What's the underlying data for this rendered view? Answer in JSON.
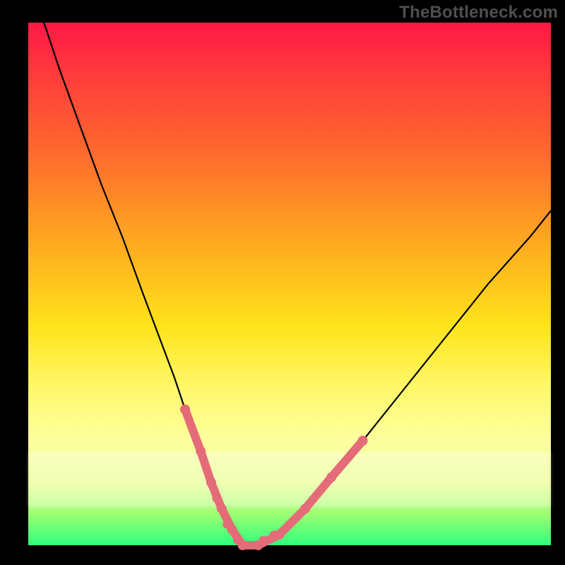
{
  "watermark_text": "TheBottleneck.com",
  "colors": {
    "background": "#000000",
    "gradient_top": "#ff1846",
    "gradient_mid": "#ffe31a",
    "gradient_bottom": "#2fff7c",
    "curve": "#000000",
    "marker": "#e46c78",
    "watermark": "#4f4f4f"
  },
  "chart_data": {
    "type": "line",
    "title": "",
    "xlabel": "",
    "ylabel": "",
    "xlim": [
      0,
      100
    ],
    "ylim": [
      0,
      100
    ],
    "grid": false,
    "legend": false,
    "series": [
      {
        "name": "bottleneck-curve",
        "x": [
          3,
          6,
          10,
          14,
          18,
          22,
          25,
          28,
          30,
          33,
          35,
          37,
          39,
          41,
          44,
          48,
          53,
          58,
          64,
          72,
          80,
          88,
          96,
          100
        ],
        "y": [
          100,
          91,
          80,
          69,
          59,
          48,
          40,
          32,
          26,
          18,
          12,
          7,
          3,
          0,
          0,
          2,
          7,
          13,
          20,
          30,
          40,
          50,
          59,
          64
        ]
      }
    ],
    "highlight_band": {
      "y_range": [
        0,
        26
      ],
      "description": "Salmon dotted/segment overlay on the curve where y is within the lower band"
    },
    "notes": "Background is a vertical rainbow gradient (red top → green bottom) with a pale lightened band near y≈8–18. Axes are implied by black frame borders; no tick labels or numeric axis annotations are visible. Values are estimated from pixel positions since the chart has no explicit scale."
  }
}
